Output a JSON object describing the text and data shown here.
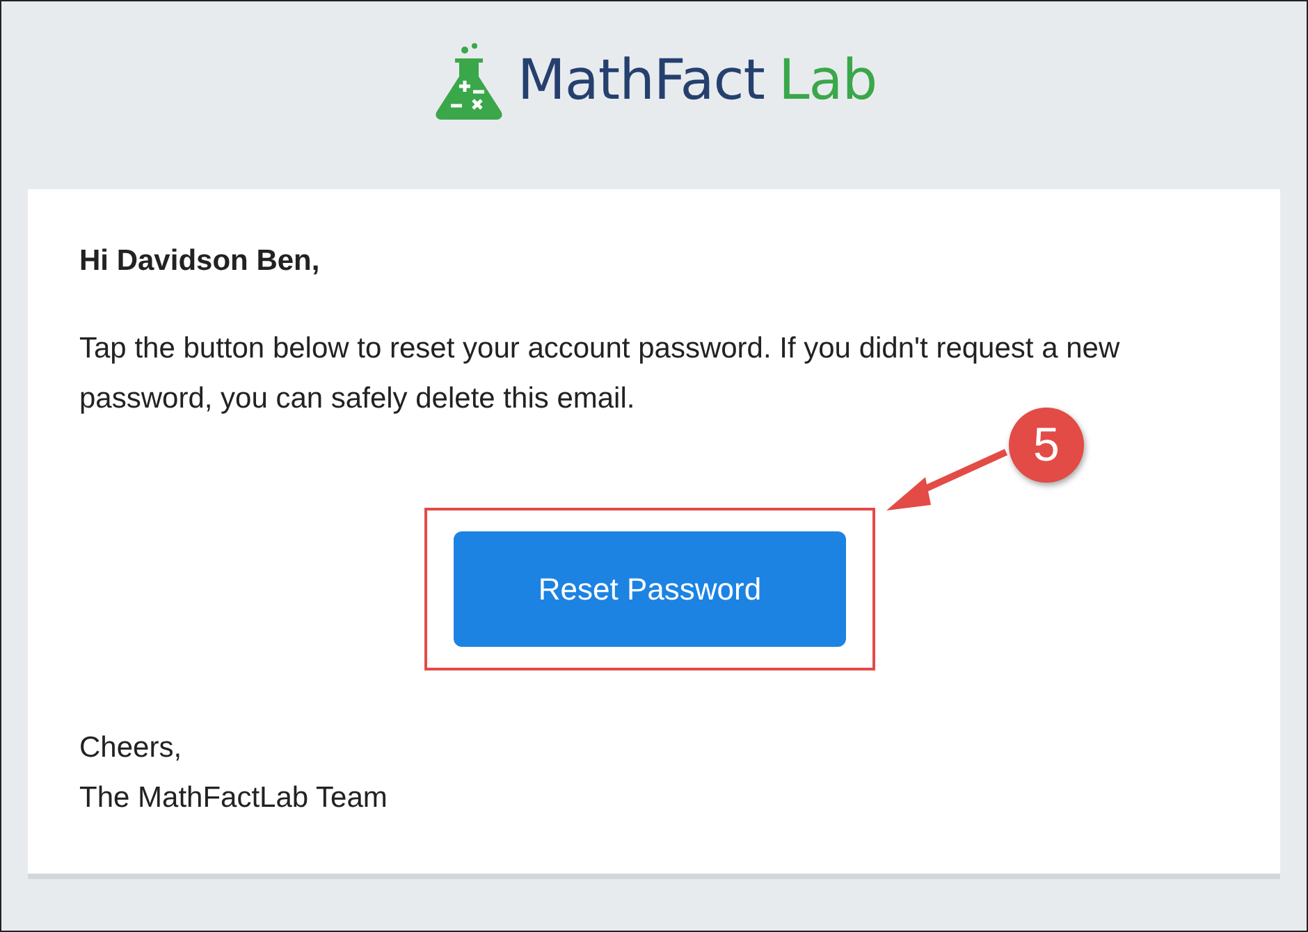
{
  "logo": {
    "name_part_1": "MathFact",
    "name_part_2": "Lab"
  },
  "email": {
    "greeting": "Hi Davidson Ben,",
    "body": "Tap the button below to reset your account password. If you didn't request a new password, you can safely delete this email.",
    "button": "Reset Password",
    "signoff": [
      "Cheers,",
      "The MathFactLab Team"
    ]
  },
  "annotation": {
    "step": "5"
  }
}
